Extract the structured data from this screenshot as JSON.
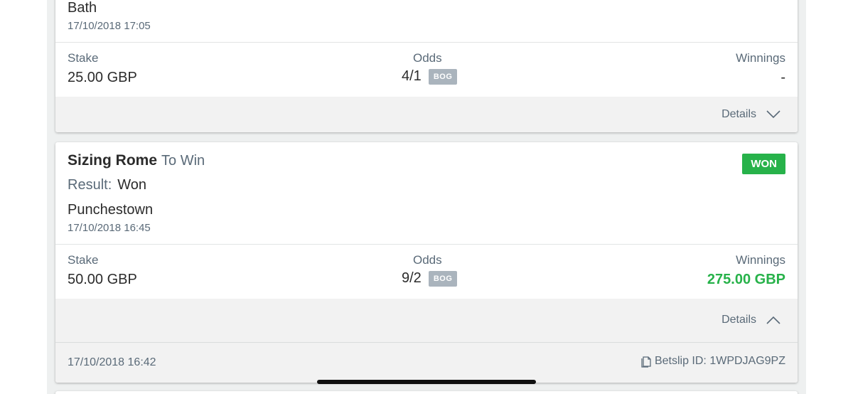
{
  "bet1": {
    "venue": "Bath",
    "date": "17/10/2018 17:05",
    "stake_label": "Stake",
    "stake_value": "25.00 GBP",
    "odds_label": "Odds",
    "odds_value": "4/1",
    "odds_badge": "BOG",
    "winnings_label": "Winnings",
    "winnings_value": "-",
    "details_label": "Details",
    "details_icon": "chevron-down-icon"
  },
  "bet2": {
    "selection": "Sizing Rome",
    "market": "To Win",
    "status_badge": "WON",
    "result_label": "Result:",
    "result_value": "Won",
    "venue": "Punchestown",
    "date": "17/10/2018 16:45",
    "stake_label": "Stake",
    "stake_value": "50.00 GBP",
    "odds_label": "Odds",
    "odds_value": "9/2",
    "odds_badge": "BOG",
    "winnings_label": "Winnings",
    "winnings_value": "275.00 GBP",
    "details_label": "Details",
    "details_icon": "chevron-up-icon",
    "placed_date": "17/10/2018 16:42",
    "betslip_icon": "copy-icon",
    "betslip_id": "Betslip ID: 1WPDJAG9PZ"
  },
  "colors": {
    "won_green": "#27b24a",
    "badge_grey": "#aab4bd",
    "muted_text": "#5a6a78",
    "panel_grey": "#f2f2f2"
  }
}
